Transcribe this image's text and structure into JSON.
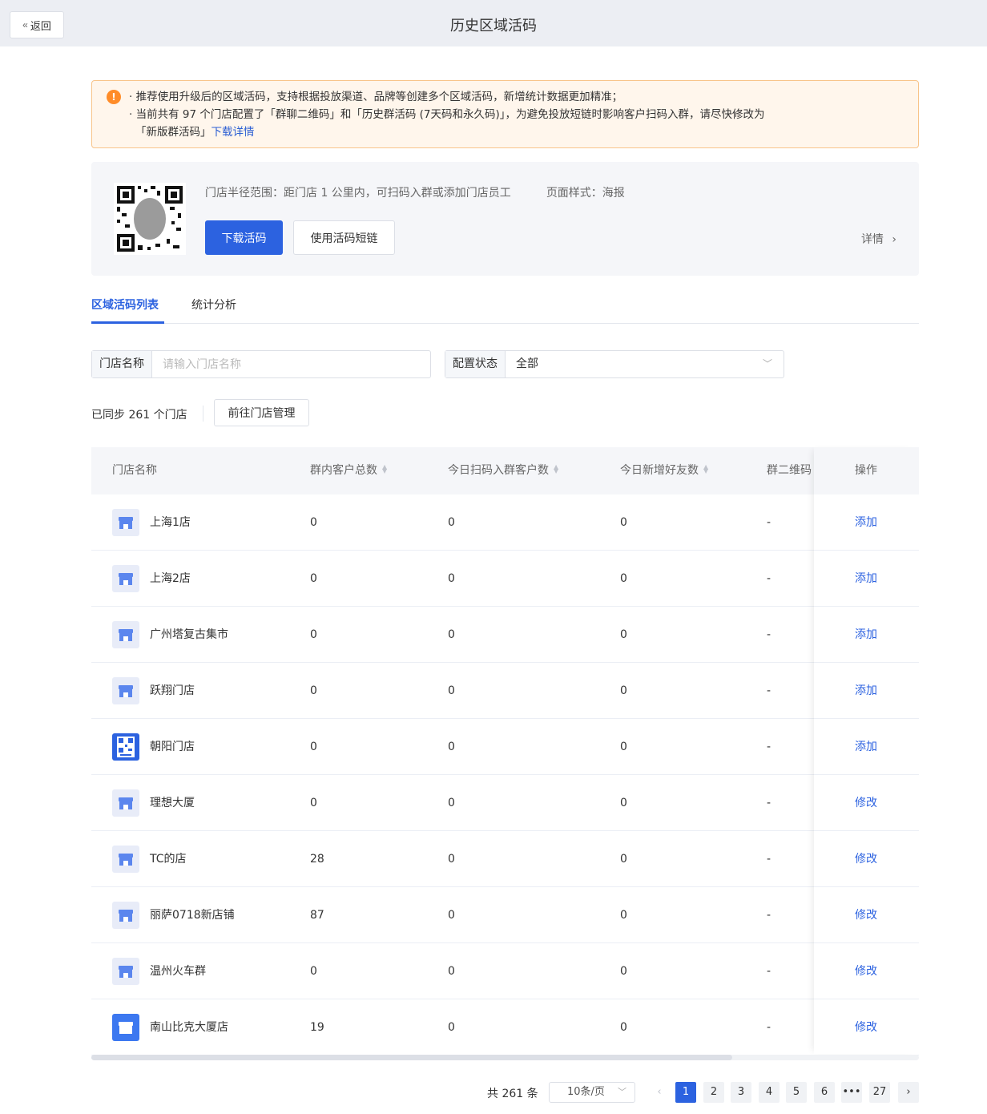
{
  "header": {
    "back_label": "返回",
    "title": "历史区域活码"
  },
  "alert": {
    "line1": "· 推荐使用升级后的区域活码，支持根据投放渠道、品牌等创建多个区域活码，新增统计数据更加精准；",
    "line2": "· 当前共有 97 个门店配置了「群聊二维码」和「历史群活码 (7天码和永久码)」，为避免投放短链时影响客户扫码入群，请尽快修改为",
    "line3": "「新版群活码」",
    "link": "下载详情"
  },
  "card": {
    "radius_text": "门店半径范围：距门店 1 公里内，可扫码入群或添加门店员工",
    "style_text": "页面样式：海报",
    "download_label": "下载活码",
    "shortlink_label": "使用活码短链",
    "detail_label": "详情"
  },
  "tabs": [
    {
      "label": "区域活码列表",
      "active": true
    },
    {
      "label": "统计分析",
      "active": false
    }
  ],
  "filters": {
    "store_label": "门店名称",
    "store_placeholder": "请输入门店名称",
    "status_label": "配置状态",
    "status_value": "全部"
  },
  "sync": {
    "text": "已同步 261 个门店",
    "manage_label": "前往门店管理"
  },
  "table": {
    "columns": [
      "门店名称",
      "群内客户总数",
      "今日扫码入群客户数",
      "今日新增好友数",
      "群二维码",
      "操作"
    ],
    "rows": [
      {
        "name": "上海1店",
        "total": "0",
        "scan": "0",
        "friends": "0",
        "qr": "-",
        "action": "添加",
        "icon": "light"
      },
      {
        "name": "上海2店",
        "total": "0",
        "scan": "0",
        "friends": "0",
        "qr": "-",
        "action": "添加",
        "icon": "light"
      },
      {
        "name": "广州塔复古集市",
        "total": "0",
        "scan": "0",
        "friends": "0",
        "qr": "-",
        "action": "添加",
        "icon": "light"
      },
      {
        "name": "跃翔门店",
        "total": "0",
        "scan": "0",
        "friends": "0",
        "qr": "-",
        "action": "添加",
        "icon": "light"
      },
      {
        "name": "朝阳门店",
        "total": "0",
        "scan": "0",
        "friends": "0",
        "qr": "-",
        "action": "添加",
        "icon": "image"
      },
      {
        "name": "理想大厦",
        "total": "0",
        "scan": "0",
        "friends": "0",
        "qr": "-",
        "action": "修改",
        "icon": "light"
      },
      {
        "name": "TC的店",
        "total": "28",
        "scan": "0",
        "friends": "0",
        "qr": "-",
        "action": "修改",
        "icon": "light"
      },
      {
        "name": "丽萨0718新店铺",
        "total": "87",
        "scan": "0",
        "friends": "0",
        "qr": "-",
        "action": "修改",
        "icon": "light"
      },
      {
        "name": "温州火车群",
        "total": "0",
        "scan": "0",
        "friends": "0",
        "qr": "-",
        "action": "修改",
        "icon": "light"
      },
      {
        "name": "南山比克大厦店",
        "total": "19",
        "scan": "0",
        "friends": "0",
        "qr": "-",
        "action": "修改",
        "icon": "dark"
      }
    ]
  },
  "pagination": {
    "total_text": "共 261 条",
    "page_size": "10条/页",
    "pages": [
      "1",
      "2",
      "3",
      "4",
      "5",
      "6",
      "•••",
      "27"
    ],
    "current": "1"
  },
  "colors": {
    "primary": "#2c62e0",
    "warning_bg": "#fff6ec",
    "warning_border": "#f8c48a",
    "warning_icon": "#ff8c28"
  }
}
